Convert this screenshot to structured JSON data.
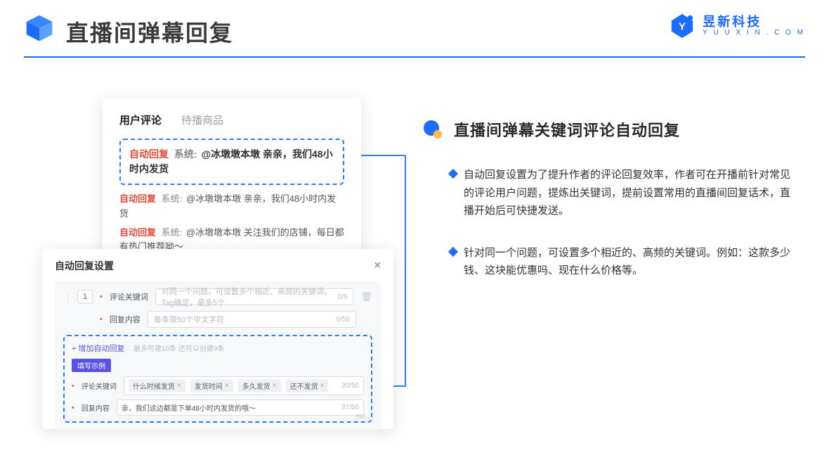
{
  "header": {
    "title": "直播间弹幕回复"
  },
  "brand": {
    "cn": "昱新科技",
    "en": "Y U U X I N . C O M"
  },
  "comments_card": {
    "tab_active": "用户评论",
    "tab_inactive": "待播商品",
    "highlight_auto": "自动回复",
    "highlight_system": "系统:",
    "highlight_text": "@冰墩墩本墩 亲亲，我们48小时内发货",
    "line2_auto": "自动回复",
    "line2_system": "系统:",
    "line2_text": "@冰墩墩本墩 亲亲，我们48小时内发货",
    "line3_auto": "自动回复",
    "line3_system": "系统:",
    "line3_text": "@冰墩墩本墩 关注我们的店铺，每日都有热门推荐呦～"
  },
  "settings_card": {
    "title": "自动回复设置",
    "order": "1",
    "keyword_label": "评论关键词",
    "keyword_placeholder": "对同一个问题，可设置多个相近、高频的关键词，Tag确定，最多5个",
    "keyword_counter": "0/5",
    "content_label": "回复内容",
    "content_placeholder": "每条限50个中文字符",
    "content_counter": "0/50",
    "add_link": "+ 增加自动回复",
    "add_hint": "最多可建10条 还可以创建9条",
    "example_badge": "填写示例",
    "ex_kw_label": "评论关键词",
    "ex_tags": [
      "什么时候发货",
      "发货时间",
      "多久发货",
      "还不发货"
    ],
    "ex_kw_counter": "20/50",
    "ex_content_label": "回复内容",
    "ex_content_value": "亲，我们这边都是下单48小时内发货的哦～",
    "ex_content_counter": "37/50",
    "ghost_counter": "/50"
  },
  "right": {
    "topic": "直播间弹幕关键词评论自动回复",
    "b1": "自动回复设置为了提升作者的评论回复效率，作者可在开播前针对常见的评论用户问题，提炼出关键词，提前设置常用的直播间回复话术，直播开始后可快捷发送。",
    "b2": "针对同一个问题，可设置多个相近的、高频的关键词。例如：这款多少钱、这块能优惠吗、现在什么价格等。"
  }
}
